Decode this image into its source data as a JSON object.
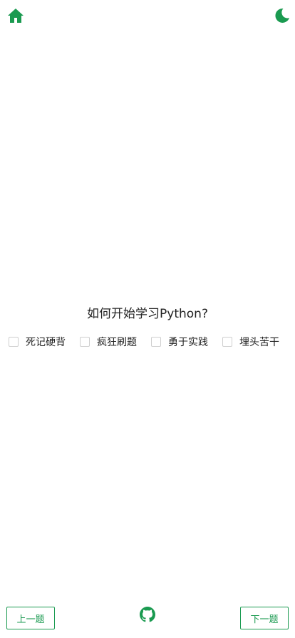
{
  "header": {
    "home_icon": "home-icon",
    "theme_icon": "moon-icon"
  },
  "quiz": {
    "question": "如何开始学习Python?",
    "options": [
      {
        "label": "死记硬背",
        "checked": false
      },
      {
        "label": "疯狂刷题",
        "checked": false
      },
      {
        "label": "勇于实践",
        "checked": false
      },
      {
        "label": "埋头苦干",
        "checked": false
      }
    ]
  },
  "footer": {
    "prev_label": "上一题",
    "next_label": "下一题",
    "github_icon": "github-icon"
  },
  "colors": {
    "accent": "#1a9a50",
    "checkbox_border": "#cfcfcf",
    "text": "#222222"
  }
}
